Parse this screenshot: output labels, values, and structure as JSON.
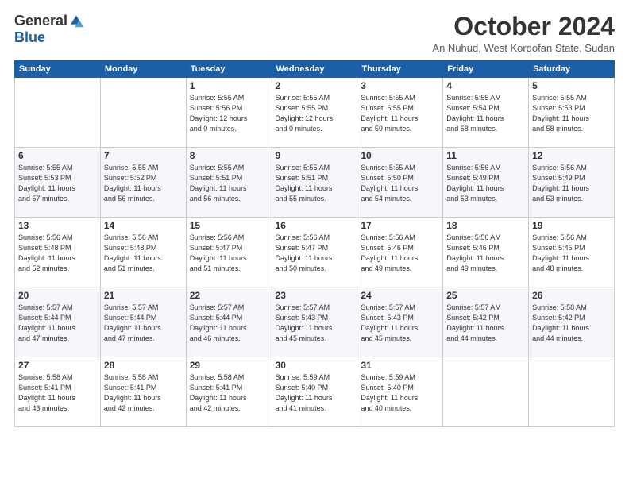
{
  "logo": {
    "general": "General",
    "blue": "Blue"
  },
  "title": "October 2024",
  "subtitle": "An Nuhud, West Kordofan State, Sudan",
  "weekdays": [
    "Sunday",
    "Monday",
    "Tuesday",
    "Wednesday",
    "Thursday",
    "Friday",
    "Saturday"
  ],
  "weeks": [
    [
      {
        "day": "",
        "info": ""
      },
      {
        "day": "",
        "info": ""
      },
      {
        "day": "1",
        "info": "Sunrise: 5:55 AM\nSunset: 5:56 PM\nDaylight: 12 hours\nand 0 minutes."
      },
      {
        "day": "2",
        "info": "Sunrise: 5:55 AM\nSunset: 5:55 PM\nDaylight: 12 hours\nand 0 minutes."
      },
      {
        "day": "3",
        "info": "Sunrise: 5:55 AM\nSunset: 5:55 PM\nDaylight: 11 hours\nand 59 minutes."
      },
      {
        "day": "4",
        "info": "Sunrise: 5:55 AM\nSunset: 5:54 PM\nDaylight: 11 hours\nand 58 minutes."
      },
      {
        "day": "5",
        "info": "Sunrise: 5:55 AM\nSunset: 5:53 PM\nDaylight: 11 hours\nand 58 minutes."
      }
    ],
    [
      {
        "day": "6",
        "info": "Sunrise: 5:55 AM\nSunset: 5:53 PM\nDaylight: 11 hours\nand 57 minutes."
      },
      {
        "day": "7",
        "info": "Sunrise: 5:55 AM\nSunset: 5:52 PM\nDaylight: 11 hours\nand 56 minutes."
      },
      {
        "day": "8",
        "info": "Sunrise: 5:55 AM\nSunset: 5:51 PM\nDaylight: 11 hours\nand 56 minutes."
      },
      {
        "day": "9",
        "info": "Sunrise: 5:55 AM\nSunset: 5:51 PM\nDaylight: 11 hours\nand 55 minutes."
      },
      {
        "day": "10",
        "info": "Sunrise: 5:55 AM\nSunset: 5:50 PM\nDaylight: 11 hours\nand 54 minutes."
      },
      {
        "day": "11",
        "info": "Sunrise: 5:56 AM\nSunset: 5:49 PM\nDaylight: 11 hours\nand 53 minutes."
      },
      {
        "day": "12",
        "info": "Sunrise: 5:56 AM\nSunset: 5:49 PM\nDaylight: 11 hours\nand 53 minutes."
      }
    ],
    [
      {
        "day": "13",
        "info": "Sunrise: 5:56 AM\nSunset: 5:48 PM\nDaylight: 11 hours\nand 52 minutes."
      },
      {
        "day": "14",
        "info": "Sunrise: 5:56 AM\nSunset: 5:48 PM\nDaylight: 11 hours\nand 51 minutes."
      },
      {
        "day": "15",
        "info": "Sunrise: 5:56 AM\nSunset: 5:47 PM\nDaylight: 11 hours\nand 51 minutes."
      },
      {
        "day": "16",
        "info": "Sunrise: 5:56 AM\nSunset: 5:47 PM\nDaylight: 11 hours\nand 50 minutes."
      },
      {
        "day": "17",
        "info": "Sunrise: 5:56 AM\nSunset: 5:46 PM\nDaylight: 11 hours\nand 49 minutes."
      },
      {
        "day": "18",
        "info": "Sunrise: 5:56 AM\nSunset: 5:46 PM\nDaylight: 11 hours\nand 49 minutes."
      },
      {
        "day": "19",
        "info": "Sunrise: 5:56 AM\nSunset: 5:45 PM\nDaylight: 11 hours\nand 48 minutes."
      }
    ],
    [
      {
        "day": "20",
        "info": "Sunrise: 5:57 AM\nSunset: 5:44 PM\nDaylight: 11 hours\nand 47 minutes."
      },
      {
        "day": "21",
        "info": "Sunrise: 5:57 AM\nSunset: 5:44 PM\nDaylight: 11 hours\nand 47 minutes."
      },
      {
        "day": "22",
        "info": "Sunrise: 5:57 AM\nSunset: 5:44 PM\nDaylight: 11 hours\nand 46 minutes."
      },
      {
        "day": "23",
        "info": "Sunrise: 5:57 AM\nSunset: 5:43 PM\nDaylight: 11 hours\nand 45 minutes."
      },
      {
        "day": "24",
        "info": "Sunrise: 5:57 AM\nSunset: 5:43 PM\nDaylight: 11 hours\nand 45 minutes."
      },
      {
        "day": "25",
        "info": "Sunrise: 5:57 AM\nSunset: 5:42 PM\nDaylight: 11 hours\nand 44 minutes."
      },
      {
        "day": "26",
        "info": "Sunrise: 5:58 AM\nSunset: 5:42 PM\nDaylight: 11 hours\nand 44 minutes."
      }
    ],
    [
      {
        "day": "27",
        "info": "Sunrise: 5:58 AM\nSunset: 5:41 PM\nDaylight: 11 hours\nand 43 minutes."
      },
      {
        "day": "28",
        "info": "Sunrise: 5:58 AM\nSunset: 5:41 PM\nDaylight: 11 hours\nand 42 minutes."
      },
      {
        "day": "29",
        "info": "Sunrise: 5:58 AM\nSunset: 5:41 PM\nDaylight: 11 hours\nand 42 minutes."
      },
      {
        "day": "30",
        "info": "Sunrise: 5:59 AM\nSunset: 5:40 PM\nDaylight: 11 hours\nand 41 minutes."
      },
      {
        "day": "31",
        "info": "Sunrise: 5:59 AM\nSunset: 5:40 PM\nDaylight: 11 hours\nand 40 minutes."
      },
      {
        "day": "",
        "info": ""
      },
      {
        "day": "",
        "info": ""
      }
    ]
  ]
}
